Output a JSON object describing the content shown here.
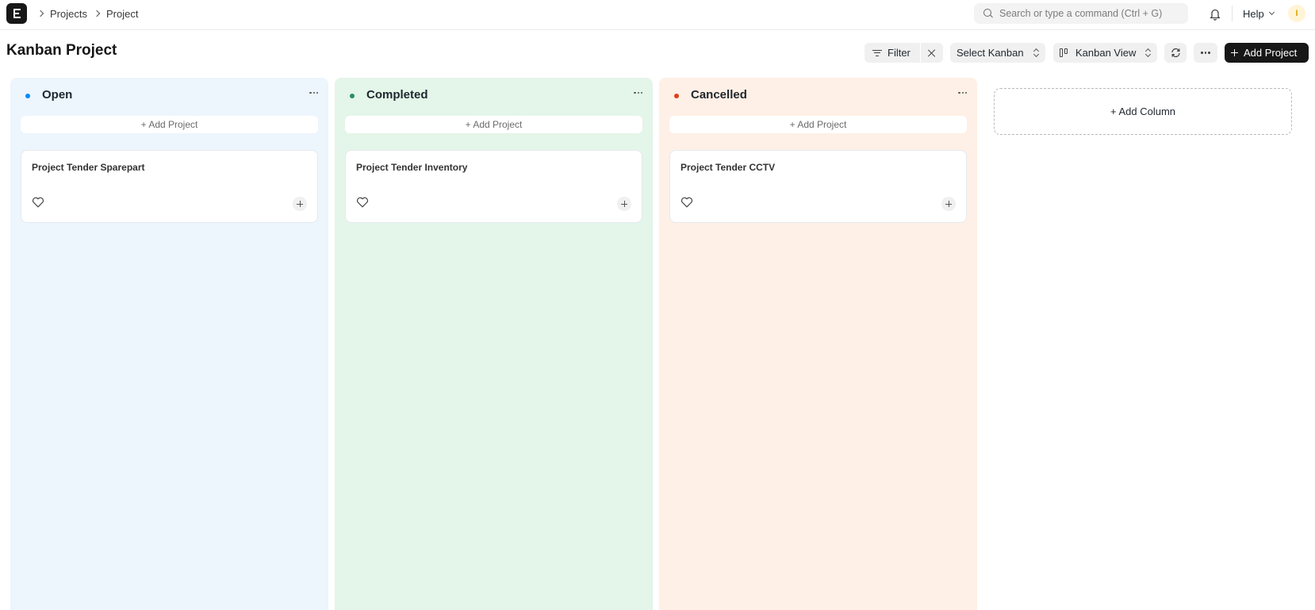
{
  "navbar": {
    "breadcrumbs": [
      "Projects",
      "Project"
    ],
    "search_placeholder": "Search or type a command (Ctrl + G)",
    "help_label": "Help",
    "avatar_initial": "I"
  },
  "page": {
    "title": "Kanban Project"
  },
  "toolbar": {
    "filter_label": "Filter",
    "select_kanban_label": "Select Kanban",
    "view_label": "Kanban View",
    "add_label": "Add Project"
  },
  "columns": [
    {
      "title": "Open",
      "color": "#0289f7",
      "add_label": "+ Add Project",
      "cards": [
        {
          "title": "Project Tender Sparepart"
        }
      ]
    },
    {
      "title": "Completed",
      "color": "#278f5e",
      "add_label": "+ Add Project",
      "cards": [
        {
          "title": "Project Tender Inventory"
        }
      ]
    },
    {
      "title": "Cancelled",
      "color": "#e03e1a",
      "add_label": "+ Add Project",
      "cards": [
        {
          "title": "Project Tender CCTV"
        }
      ]
    }
  ],
  "add_column_label": "+ Add Column"
}
